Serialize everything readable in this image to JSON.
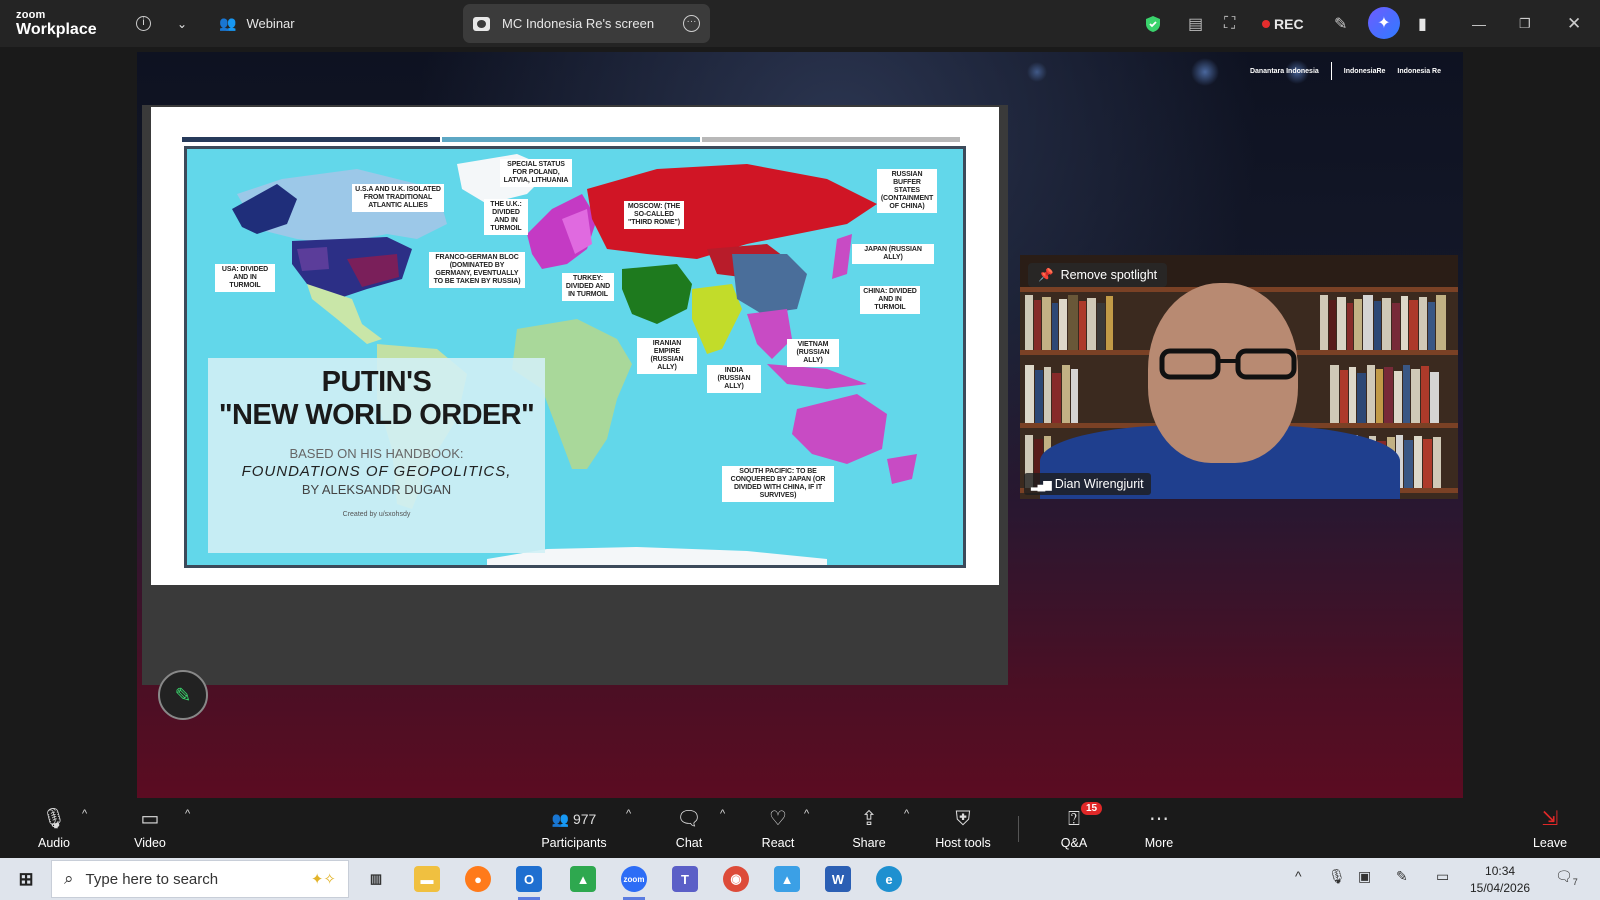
{
  "titlebar": {
    "logo_top": "zoom",
    "logo_bottom": "Workplace",
    "webinar_label": "Webinar",
    "share_label": "MC Indonesia Re's screen",
    "rec_label": "REC"
  },
  "slide": {
    "sponsors": [
      "Danantara Indonesia",
      "IndonesiaRe",
      "Indonesia Re"
    ],
    "title_line1": "PUTIN'S",
    "title_line2": "\"NEW WORLD ORDER\"",
    "subtitle1": "BASED ON HIS HANDBOOK:",
    "subtitle2": "FOUNDATIONS OF GEOPOLITICS,",
    "subtitle3": "BY ALEKSANDR DUGAN",
    "credit": "Created by u/sxohsdy",
    "labels": {
      "usa_uk": "U.S.A AND U.K. ISOLATED FROM TRADITIONAL ATLANTIC ALLIES",
      "special": "SPECIAL STATUS FOR POLAND, LATVIA, LITHUANIA",
      "uk": "THE U.K.: DIVIDED AND IN TURMOIL",
      "moscow": "MOSCOW: (THE SO-CALLED \"THIRD ROME\")",
      "buffer": "RUSSIAN BUFFER STATES (CONTAINMENT OF CHINA)",
      "japan": "JAPAN (RUSSIAN ALLY)",
      "usa": "USA: DIVIDED AND IN TURMOIL",
      "franco": "FRANCO-GERMAN BLOC (DOMINATED BY GERMANY, EVENTUALLY TO BE TAKEN BY RUSSIA)",
      "turkey": "TURKEY: DIVIDED AND IN TURMOIL",
      "china": "CHINA: DIVIDED AND IN TURMOIL",
      "iran": "IRANIAN EMPIRE (RUSSIAN ALLY)",
      "vietnam": "VIETNAM (RUSSIAN ALLY)",
      "india": "INDIA (RUSSIAN ALLY)",
      "pacific": "SOUTH PACIFIC: TO BE CONQUERED BY JAPAN (OR DIVIDED WITH CHINA, IF IT SURVIVES)"
    }
  },
  "video": {
    "spotlight_label": "Remove spotlight",
    "participant_name": "Dian Wirengjurit"
  },
  "toolbar": {
    "audio": "Audio",
    "video": "Video",
    "participants": "Participants",
    "participants_count": "977",
    "chat": "Chat",
    "react": "React",
    "share": "Share",
    "host_tools": "Host tools",
    "qa": "Q&A",
    "qa_badge": "15",
    "more": "More",
    "leave": "Leave"
  },
  "taskbar": {
    "search_placeholder": "Type here to search",
    "time": "10:34",
    "date": "15/04/2026",
    "notification_count": "7"
  },
  "colors": {
    "accent_green": "#3ad36c",
    "rec_red": "#e52d2d",
    "leave_red": "#e02828"
  }
}
